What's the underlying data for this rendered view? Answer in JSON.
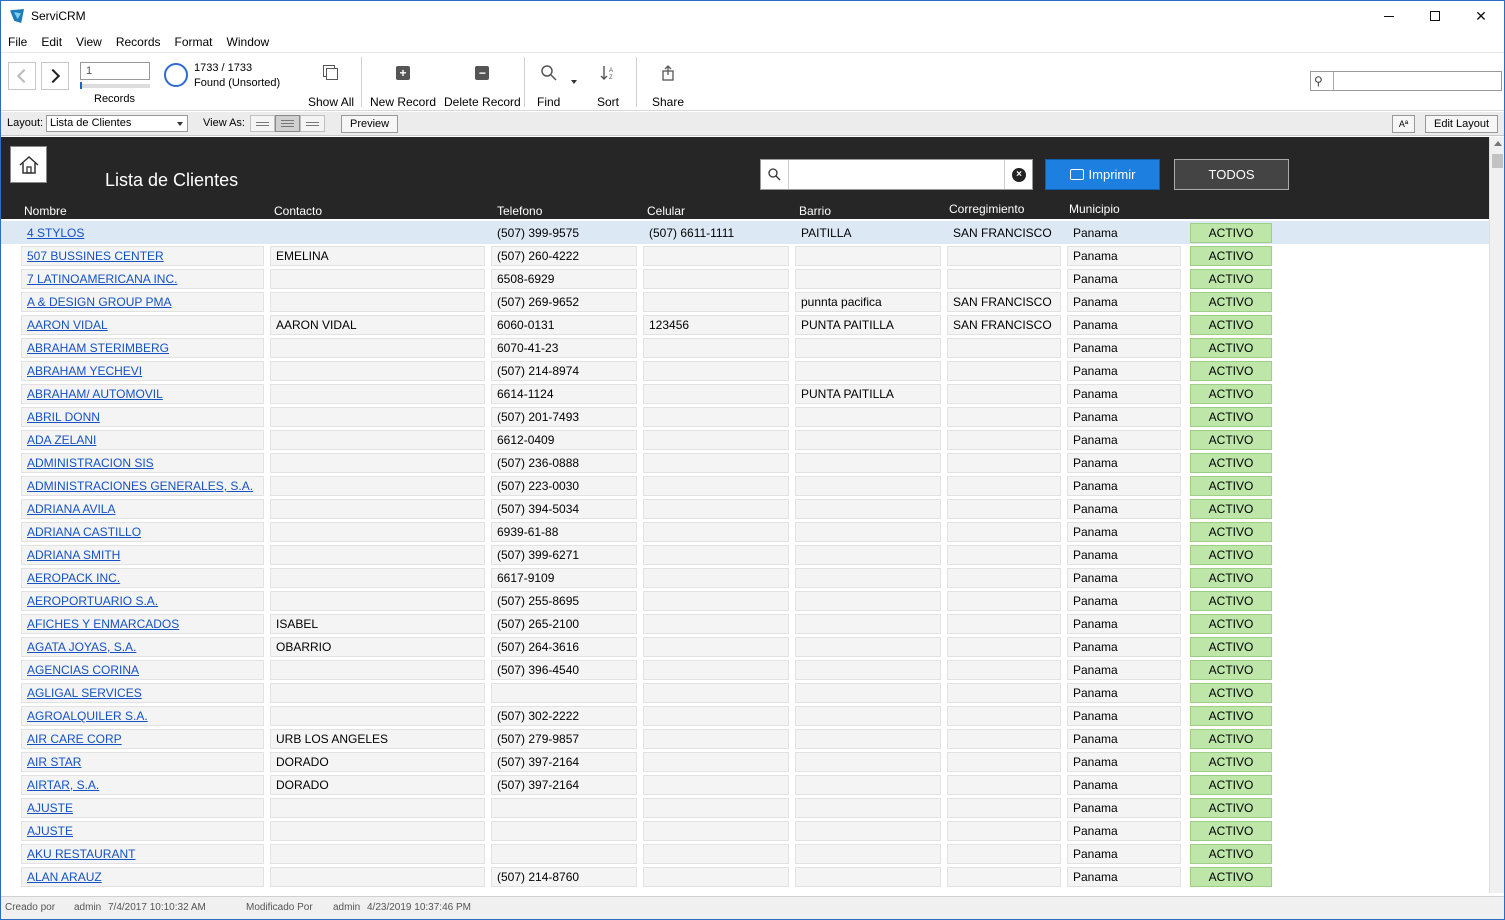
{
  "window": {
    "title": "ServiCRM"
  },
  "menu": [
    "File",
    "Edit",
    "View",
    "Records",
    "Format",
    "Window"
  ],
  "toolbar": {
    "record_number": "1",
    "records_label": "Records",
    "found_count": "1733 / 1733",
    "found_state": "Found (Unsorted)",
    "show_all": "Show All",
    "new_record": "New Record",
    "delete_record": "Delete Record",
    "find": "Find",
    "sort": "Sort",
    "share": "Share"
  },
  "layoutbar": {
    "layout_label": "Layout:",
    "layout_value": "Lista de Clientes",
    "view_as_label": "View As:",
    "preview": "Preview",
    "aa": "Aª",
    "edit_layout": "Edit Layout"
  },
  "header": {
    "title": "Lista de Clientes",
    "print_label": "Imprimir",
    "todos_label": "TODOS"
  },
  "columns": [
    "Nombre",
    "Contacto",
    "Telefono",
    "Celular",
    "Barrio",
    "Corregimiento",
    "Municipio"
  ],
  "rows": [
    {
      "nombre": "4 STYLOS",
      "contacto": "",
      "telefono": "(507) 399-9575",
      "celular": "(507) 6611-1111",
      "barrio": "PAITILLA",
      "corregimiento": "SAN FRANCISCO",
      "municipio": "Panama",
      "estado": "ACTIVO"
    },
    {
      "nombre": "507 BUSSINES CENTER",
      "contacto": "EMELINA",
      "telefono": "(507) 260-4222",
      "celular": "",
      "barrio": "",
      "corregimiento": "",
      "municipio": "Panama",
      "estado": "ACTIVO"
    },
    {
      "nombre": "7 LATINOAMERICANA  INC.",
      "contacto": "",
      "telefono": "6508-6929",
      "celular": "",
      "barrio": "",
      "corregimiento": "",
      "municipio": "Panama",
      "estado": "ACTIVO"
    },
    {
      "nombre": "A & DESIGN GROUP PMA",
      "contacto": "",
      "telefono": "(507) 269-9652",
      "celular": "",
      "barrio": "punnta pacifica",
      "corregimiento": "SAN FRANCISCO",
      "municipio": "Panama",
      "estado": "ACTIVO"
    },
    {
      "nombre": "AARON VIDAL",
      "contacto": "AARON VIDAL",
      "telefono": "6060-0131",
      "celular": "123456",
      "barrio": "PUNTA PAITILLA",
      "corregimiento": "SAN FRANCISCO",
      "municipio": "Panama",
      "estado": "ACTIVO"
    },
    {
      "nombre": "ABRAHAM STERIMBERG",
      "contacto": "",
      "telefono": "6070-41-23",
      "celular": "",
      "barrio": "",
      "corregimiento": "",
      "municipio": "Panama",
      "estado": "ACTIVO"
    },
    {
      "nombre": "ABRAHAM YECHEVI",
      "contacto": "",
      "telefono": "(507) 214-8974",
      "celular": "",
      "barrio": "",
      "corregimiento": "",
      "municipio": "Panama",
      "estado": "ACTIVO"
    },
    {
      "nombre": "ABRAHAM/ AUTOMOVIL",
      "contacto": "",
      "telefono": "6614-1124",
      "celular": "",
      "barrio": "PUNTA PAITILLA",
      "corregimiento": "",
      "municipio": "Panama",
      "estado": "ACTIVO"
    },
    {
      "nombre": "ABRIL DONN",
      "contacto": "",
      "telefono": "(507) 201-7493",
      "celular": "",
      "barrio": "",
      "corregimiento": "",
      "municipio": "Panama",
      "estado": "ACTIVO"
    },
    {
      "nombre": "ADA ZELANI",
      "contacto": "",
      "telefono": "6612-0409",
      "celular": "",
      "barrio": "",
      "corregimiento": "",
      "municipio": "Panama",
      "estado": "ACTIVO"
    },
    {
      "nombre": "ADMINISTRACION SIS",
      "contacto": "",
      "telefono": "(507) 236-0888",
      "celular": "",
      "barrio": "",
      "corregimiento": "",
      "municipio": "Panama",
      "estado": "ACTIVO"
    },
    {
      "nombre": "ADMINISTRACIONES GENERALES, S.A.",
      "contacto": "",
      "telefono": "(507) 223-0030",
      "celular": "",
      "barrio": "",
      "corregimiento": "",
      "municipio": "Panama",
      "estado": "ACTIVO"
    },
    {
      "nombre": "ADRIANA AVILA",
      "contacto": "",
      "telefono": "(507) 394-5034",
      "celular": "",
      "barrio": "",
      "corregimiento": "",
      "municipio": "Panama",
      "estado": "ACTIVO"
    },
    {
      "nombre": "ADRIANA CASTILLO",
      "contacto": "",
      "telefono": "6939-61-88",
      "celular": "",
      "barrio": "",
      "corregimiento": "",
      "municipio": "Panama",
      "estado": "ACTIVO"
    },
    {
      "nombre": "ADRIANA SMITH",
      "contacto": "",
      "telefono": "(507) 399-6271",
      "celular": "",
      "barrio": "",
      "corregimiento": "",
      "municipio": "Panama",
      "estado": "ACTIVO"
    },
    {
      "nombre": "AEROPACK INC.",
      "contacto": "",
      "telefono": "6617-9109",
      "celular": "",
      "barrio": "",
      "corregimiento": "",
      "municipio": "Panama",
      "estado": "ACTIVO"
    },
    {
      "nombre": "AEROPORTUARIO S.A.",
      "contacto": "",
      "telefono": "(507) 255-8695",
      "celular": "",
      "barrio": "",
      "corregimiento": "",
      "municipio": "Panama",
      "estado": "ACTIVO"
    },
    {
      "nombre": "AFICHES Y ENMARCADOS",
      "contacto": "ISABEL",
      "telefono": "(507) 265-2100",
      "celular": "",
      "barrio": "",
      "corregimiento": "",
      "municipio": "Panama",
      "estado": "ACTIVO"
    },
    {
      "nombre": "AGATA JOYAS, S.A.",
      "contacto": " OBARRIO",
      "telefono": "(507) 264-3616",
      "celular": "",
      "barrio": "",
      "corregimiento": "",
      "municipio": "Panama",
      "estado": "ACTIVO"
    },
    {
      "nombre": "AGENCIAS CORINA",
      "contacto": "",
      "telefono": "(507) 396-4540",
      "celular": "",
      "barrio": "",
      "corregimiento": "",
      "municipio": "Panama",
      "estado": "ACTIVO"
    },
    {
      "nombre": "AGLIGAL SERVICES",
      "contacto": "",
      "telefono": "",
      "celular": "",
      "barrio": "",
      "corregimiento": "",
      "municipio": "Panama",
      "estado": "ACTIVO"
    },
    {
      "nombre": "AGROALQUILER S.A.",
      "contacto": "",
      "telefono": "(507) 302-2222",
      "celular": "",
      "barrio": "",
      "corregimiento": "",
      "municipio": "Panama",
      "estado": "ACTIVO"
    },
    {
      "nombre": "AIR CARE CORP",
      "contacto": " URB LOS ANGELES",
      "telefono": "(507) 279-9857",
      "celular": "",
      "barrio": "",
      "corregimiento": "",
      "municipio": "Panama",
      "estado": "ACTIVO"
    },
    {
      "nombre": "AIR STAR",
      "contacto": " DORADO",
      "telefono": "(507) 397-2164",
      "celular": "",
      "barrio": "",
      "corregimiento": "",
      "municipio": "Panama",
      "estado": "ACTIVO"
    },
    {
      "nombre": "AIRTAR, S.A.",
      "contacto": "DORADO",
      "telefono": "(507) 397-2164",
      "celular": "",
      "barrio": "",
      "corregimiento": "",
      "municipio": "Panama",
      "estado": "ACTIVO"
    },
    {
      "nombre": "AJUSTE",
      "contacto": "",
      "telefono": "",
      "celular": "",
      "barrio": "",
      "corregimiento": "",
      "municipio": "Panama",
      "estado": "ACTIVO"
    },
    {
      "nombre": "AJUSTE",
      "contacto": "",
      "telefono": "",
      "celular": "",
      "barrio": "",
      "corregimiento": "",
      "municipio": "Panama",
      "estado": "ACTIVO"
    },
    {
      "nombre": "AKU RESTAURANT",
      "contacto": "",
      "telefono": "",
      "celular": "",
      "barrio": "",
      "corregimiento": "",
      "municipio": "Panama",
      "estado": "ACTIVO"
    },
    {
      "nombre": "ALAN ARAUZ",
      "contacto": "",
      "telefono": "(507) 214-8760",
      "celular": "",
      "barrio": "",
      "corregimiento": "",
      "municipio": "Panama",
      "estado": "ACTIVO"
    }
  ],
  "statusbar": {
    "created_label": "Creado por",
    "created_user": "admin",
    "created_date": "7/4/2017 10:10:32 AM",
    "modified_label": "Modificado Por",
    "modified_user": "admin",
    "modified_date": "4/23/2019 10:37:46 PM"
  },
  "colors": {
    "accent": "#1d7fe0",
    "header_bg": "#262626",
    "status_green": "#bde6a8",
    "link": "#1552c4"
  }
}
